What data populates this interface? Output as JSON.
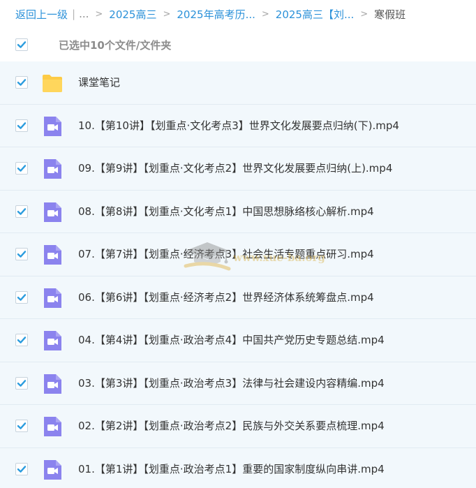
{
  "breadcrumb": {
    "back_label": "返回上一级",
    "separator": "|",
    "ellipsis": "...",
    "items": [
      {
        "label": "2025高三"
      },
      {
        "label": "2025年高考历..."
      },
      {
        "label": "2025高三【刘..."
      }
    ],
    "current": "寒假班"
  },
  "selection": {
    "text": "已选中10个文件/文件夹",
    "all_checked": true
  },
  "files": [
    {
      "type": "folder",
      "name": "课堂笔记",
      "checked": true
    },
    {
      "type": "video",
      "name": "10.【第10讲】【划重点·文化考点3】世界文化发展要点归纳(下).mp4",
      "checked": true
    },
    {
      "type": "video",
      "name": "09.【第9讲】【划重点·文化考点2】世界文化发展要点归纳(上).mp4",
      "checked": true
    },
    {
      "type": "video",
      "name": "08.【第8讲】【划重点·文化考点1】中国思想脉络核心解析.mp4",
      "checked": true
    },
    {
      "type": "video",
      "name": "07.【第7讲】【划重点·经济考点3】社会生活专题重点研习.mp4",
      "checked": true
    },
    {
      "type": "video",
      "name": "06.【第6讲】【划重点·经济考点2】世界经济体系统筹盘点.mp4",
      "checked": true
    },
    {
      "type": "video",
      "name": "04.【第4讲】【划重点·政治考点4】中国共产党历史专题总结.mp4",
      "checked": true
    },
    {
      "type": "video",
      "name": "03.【第3讲】【划重点·政治考点3】法律与社会建设内容精编.mp4",
      "checked": true
    },
    {
      "type": "video",
      "name": "02.【第2讲】【划重点·政治考点2】民族与外交关系要点梳理.mp4",
      "checked": true
    },
    {
      "type": "video",
      "name": "01.【第1讲】【划重点·政治考点1】重要的国家制度纵向串讲.mp4",
      "checked": true
    }
  ],
  "watermark": {
    "text": "www.xue-ba.org"
  },
  "colors": {
    "link": "#2b91d9",
    "check": "#2b9cde",
    "folder": "#fdcb46",
    "video": "#8b83ee",
    "row_bg": "#f2f8fc"
  }
}
